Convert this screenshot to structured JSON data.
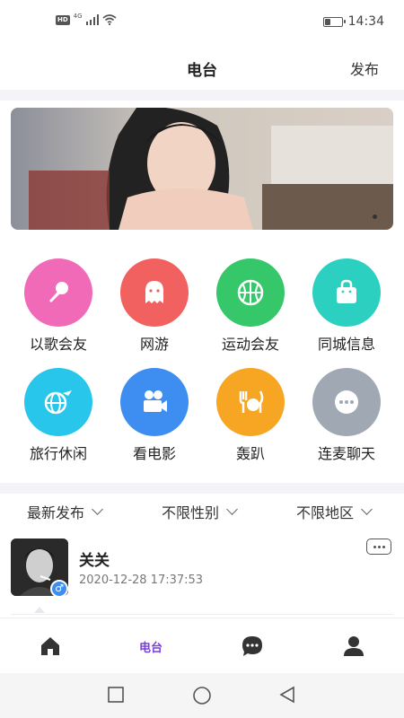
{
  "status_bar": {
    "network_badge": "HD",
    "network_type": "4G",
    "battery_level": 0.35,
    "time": "14:34"
  },
  "header": {
    "title": "电台",
    "publish_label": "发布"
  },
  "categories": [
    {
      "label": "以歌会友",
      "icon": "microphone-icon",
      "color": "#f06ab8"
    },
    {
      "label": "网游",
      "icon": "ghost-icon",
      "color": "#f1615f"
    },
    {
      "label": "运动会友",
      "icon": "basketball-icon",
      "color": "#35c76a"
    },
    {
      "label": "同城信息",
      "icon": "shopping-bag-icon",
      "color": "#2bd0c0"
    },
    {
      "label": "旅行休闲",
      "icon": "globe-plane-icon",
      "color": "#27c6ea"
    },
    {
      "label": "看电影",
      "icon": "movie-camera-icon",
      "color": "#3d8ef0"
    },
    {
      "label": "轰趴",
      "icon": "party-icon",
      "color": "#f6a623"
    },
    {
      "label": "连麦聊天",
      "icon": "chat-bubble-icon",
      "color": "#a0a8b4"
    }
  ],
  "filters": {
    "sort": "最新发布",
    "gender": "不限性别",
    "region": "不限地区"
  },
  "post": {
    "name": "关关",
    "time": "2020-12-28 17:37:53",
    "gender": "male"
  },
  "tabs": [
    {
      "icon": "home-icon",
      "label": ""
    },
    {
      "icon": "",
      "label": "电台",
      "active": true
    },
    {
      "icon": "chat-icon",
      "label": ""
    },
    {
      "icon": "profile-icon",
      "label": ""
    }
  ],
  "colors": {
    "accent": "#7b3fe0",
    "background_band": "#f4f3f8"
  }
}
